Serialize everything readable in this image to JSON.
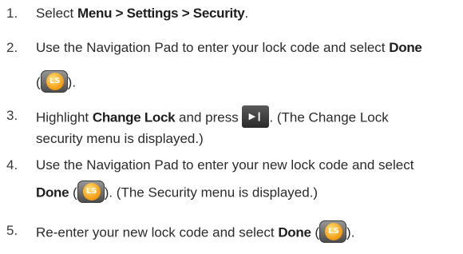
{
  "steps": [
    {
      "number": "1.",
      "lines": [
        {
          "t1": "Select ",
          "b1": "Menu > Settings > Security",
          "t2": "."
        }
      ]
    },
    {
      "number": "2.",
      "lines": [
        {
          "t1": "Use the Navigation Pad to enter your lock code and select ",
          "b1": "Done"
        },
        {
          "t1": "(",
          "t2": ")."
        }
      ]
    },
    {
      "number": "3.",
      "lines": [
        {
          "t1": "Highlight ",
          "b1": "Change Lock",
          "t2": " and press ",
          "t3": ". (The Change Lock"
        },
        {
          "t1": "security menu is displayed.)"
        }
      ]
    },
    {
      "number": "4.",
      "lines": [
        {
          "t1": "Use the Navigation Pad to enter your new lock code and select"
        },
        {
          "b1": "Done",
          "t1": " (",
          "t2": "). (The Security menu is displayed.)"
        }
      ]
    },
    {
      "number": "5.",
      "lines": [
        {
          "t1": "Re-enter your new lock code and select ",
          "b1": "Done",
          "t2": " (",
          "t3": ")."
        }
      ]
    }
  ],
  "icons": {
    "ls_label": "LS",
    "play_pause_glyph": "▶❙"
  }
}
